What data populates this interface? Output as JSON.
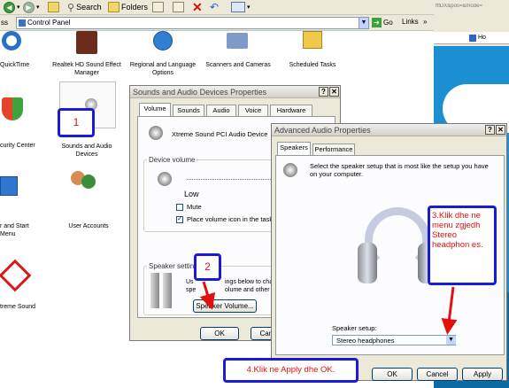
{
  "explorer": {
    "toolbar": {
      "search_label": "Search",
      "folders_label": "Folders"
    },
    "address": {
      "prefix_label": "ss",
      "value": "Control Panel",
      "go_label": "Go",
      "links_label": "Links"
    },
    "icons": [
      {
        "label": "QuickTime"
      },
      {
        "label": "Realtek HD Sound Effect Manager"
      },
      {
        "label": "Regional and Language Options"
      },
      {
        "label": "Scanners and Cameras"
      },
      {
        "label": "Scheduled Tasks"
      },
      {
        "label": "curity Center"
      },
      {
        "label": "Sounds and Audio Devices"
      },
      {
        "label": "r and Start Menu"
      },
      {
        "label": "User Accounts"
      },
      {
        "label": "treme Sound"
      }
    ]
  },
  "browser": {
    "url_fragment": "ffIDX&pos=&mode=",
    "tab_label": "Ho"
  },
  "sounds_dialog": {
    "title": "Sounds and Audio Devices Properties",
    "help_btn": "?",
    "close_btn": "✕",
    "tabs": [
      "Volume",
      "Sounds",
      "Audio",
      "Voice",
      "Hardware"
    ],
    "device_name": "Xtreme Sound PCI Audio Device",
    "device_volume_label": "Device volume",
    "low_label": "Low",
    "mute_label": "Mute",
    "mute_checked": "",
    "tray_label": "Place volume icon in the taskba",
    "tray_checked": "✓",
    "speaker_settings_label": "Speaker settings",
    "speaker_text_line1": "Us",
    "speaker_text_line1b": "ings below to chan",
    "speaker_text_line2": "spe",
    "speaker_text_line2b": "olume and other set",
    "speaker_volume_btn": "Speaker Volume...",
    "ok_btn": "OK",
    "cancel_btn": "Cance"
  },
  "advanced_dialog": {
    "title": "Advanced Audio Properties",
    "help_btn": "?",
    "close_btn": "✕",
    "tabs": [
      "Speakers",
      "Performance"
    ],
    "description": "Select the speaker setup that is most like the setup you have on your computer.",
    "setup_label": "Speaker setup:",
    "setup_value": "Stereo headphones",
    "ok_btn": "OK",
    "cancel_btn": "Cancel",
    "apply_btn": "Apply"
  },
  "annotations": {
    "step1": "1",
    "step2": "2",
    "step3": "3.Klik dhe ne menu zgjedh Stereo headphon es.",
    "step4": "4.Klik ne Apply dhe OK."
  },
  "colors": {
    "callout_border": "#1a1ad9",
    "callout_text": "#e21010",
    "arrow": "#e21010"
  }
}
